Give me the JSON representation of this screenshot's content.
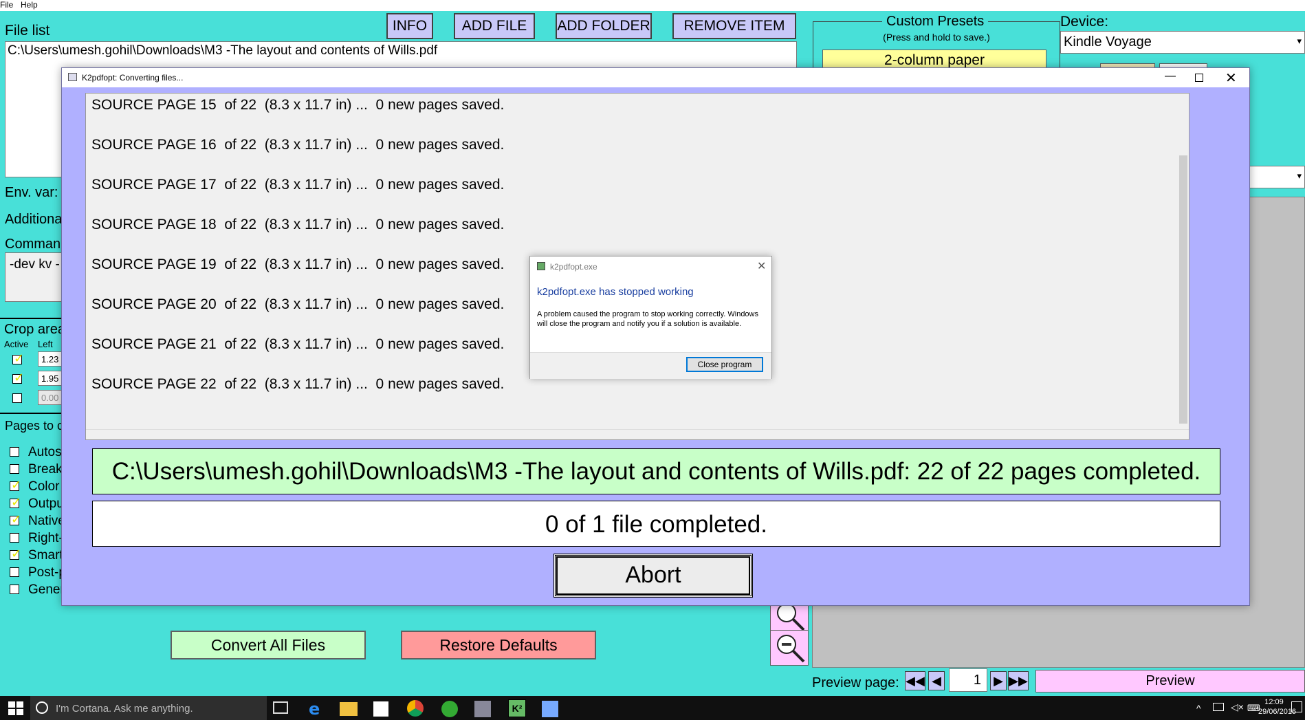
{
  "menubar": {
    "file": "File",
    "help": "Help"
  },
  "main": {
    "file_list_label": "File list",
    "buttons": {
      "info": "INFO",
      "add_file": "ADD FILE",
      "add_folder": "ADD FOLDER",
      "remove_item": "REMOVE ITEM"
    },
    "file_list_items": [
      "C:\\Users\\umesh.gohil\\Downloads\\M3 -The layout and contents of Wills.pdf"
    ],
    "env_var_label": "Env. var:",
    "additional_label": "Additiona",
    "command_label": "Comman",
    "command_value": "-dev kv -",
    "crop_areas_label": "Crop area",
    "crop_active_label": "Active",
    "crop_left_label": "Left",
    "crop_values": [
      "1.23",
      "1.95",
      "0.00"
    ],
    "pages_label": "Pages to c",
    "options": [
      {
        "label": "Autos",
        "checked": false
      },
      {
        "label": "Break",
        "checked": false
      },
      {
        "label": "Color",
        "checked": true
      },
      {
        "label": "Outpu",
        "checked": true
      },
      {
        "label": "Native",
        "checked": true
      },
      {
        "label": "Right-",
        "checked": false
      },
      {
        "label": "Smart",
        "checked": true
      },
      {
        "label": "Post-p",
        "checked": false
      },
      {
        "label": "Gener",
        "checked": false
      }
    ],
    "convert_all": "Convert All Files",
    "restore_defaults": "Restore Defaults"
  },
  "presets": {
    "title": "Custom Presets",
    "subtitle": "(Press and hold to save.)",
    "first_preset": "2-column paper"
  },
  "device": {
    "label": "Device:",
    "value": "Kindle Voyage"
  },
  "preview": {
    "label": "Preview page:",
    "page": "1",
    "button": "Preview"
  },
  "conv_window": {
    "title": "K2pdfopt: Converting files...",
    "log_lines": [
      "SOURCE PAGE 15  of 22  (8.3 x 11.7 in) ...  0 new pages saved.",
      "SOURCE PAGE 16  of 22  (8.3 x 11.7 in) ...  0 new pages saved.",
      "SOURCE PAGE 17  of 22  (8.3 x 11.7 in) ...  0 new pages saved.",
      "SOURCE PAGE 18  of 22  (8.3 x 11.7 in) ...  0 new pages saved.",
      "SOURCE PAGE 19  of 22  (8.3 x 11.7 in) ...  0 new pages saved.",
      "SOURCE PAGE 20  of 22  (8.3 x 11.7 in) ...  0 new pages saved.",
      "SOURCE PAGE 21  of 22  (8.3 x 11.7 in) ...  0 new pages saved.",
      "SOURCE PAGE 22  of 22  (8.3 x 11.7 in) ...  0 new pages saved."
    ],
    "file_status": "C:\\Users\\umesh.gohil\\Downloads\\M3 -The layout and contents of Wills.pdf: 22 of 22 pages completed.",
    "overall_status": "0 of 1 file completed.",
    "abort": "Abort"
  },
  "error_dialog": {
    "title": "k2pdfopt.exe",
    "heading": "k2pdfopt.exe has stopped working",
    "body": "A problem caused the program to stop working correctly. Windows will close the program and notify you if a solution is available.",
    "button": "Close program"
  },
  "taskbar": {
    "search_placeholder": "I'm Cortana. Ask me anything.",
    "time": "12:09",
    "date": "29/06/2016"
  },
  "colors": {
    "background": "#48e0d8",
    "conv_window_bg": "#b0b0ff",
    "status_green": "#c8ffc8",
    "convert_button": "#c8ffc8",
    "restore_button": "#ff9a9a",
    "preview_button": "#ffc8ff",
    "error_heading": "#1a3fa0"
  }
}
